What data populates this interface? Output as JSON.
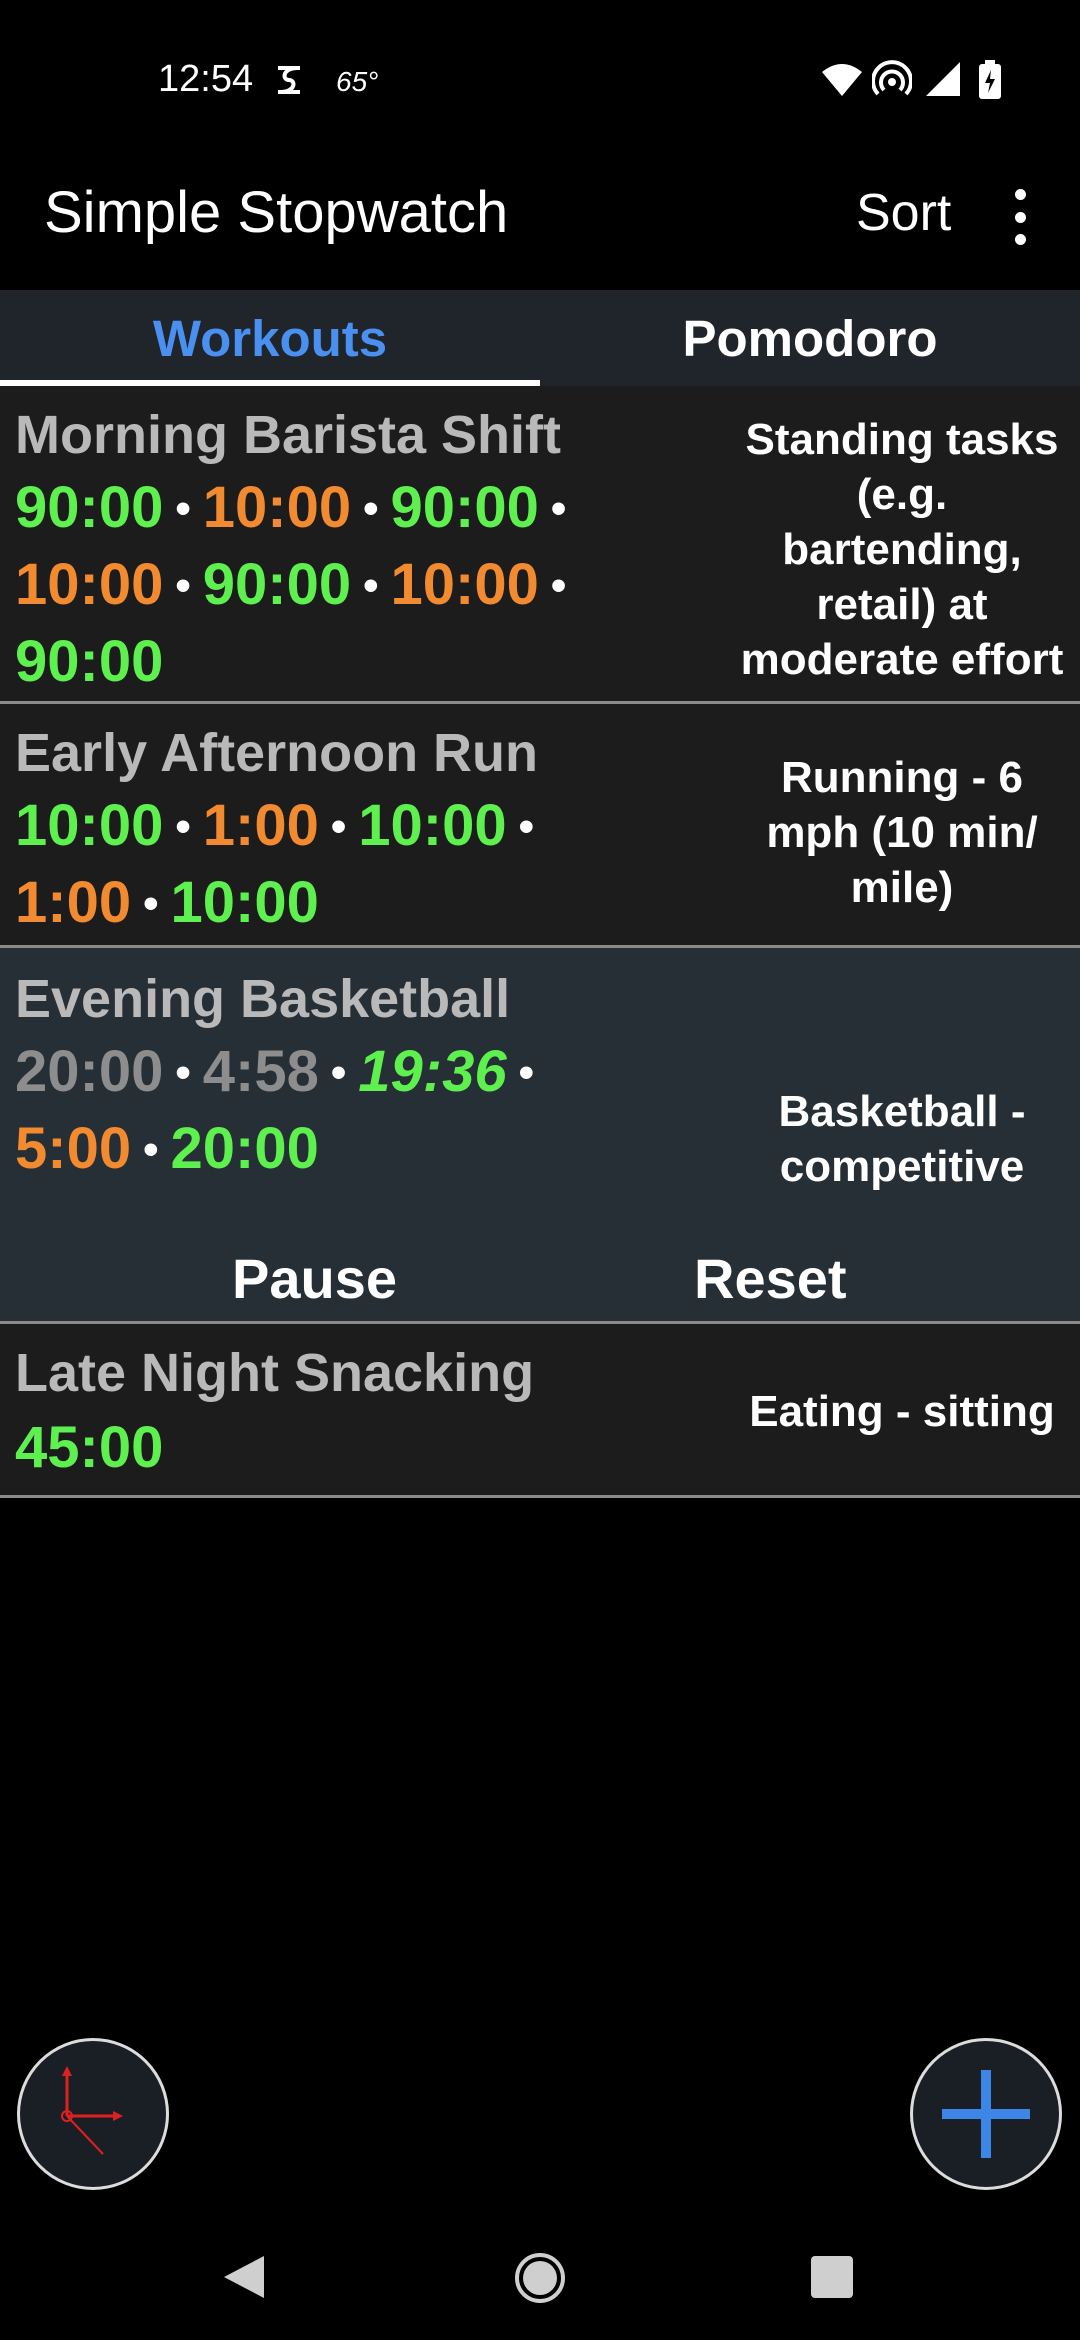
{
  "status_bar": {
    "time": "12:54",
    "temperature": "65°"
  },
  "app_bar": {
    "title": "Simple Stopwatch",
    "sort_label": "Sort",
    "more_icon": "more-vert-icon"
  },
  "tabs": [
    {
      "label": "Workouts",
      "selected": true
    },
    {
      "label": "Pomodoro",
      "selected": false
    }
  ],
  "colors": {
    "active_interval": "#5ef04e",
    "rest_interval": "#f28a30",
    "completed_interval": "#8d8d8d",
    "tab_selected": "#4a90f0",
    "fab_plus": "#3b86e6"
  },
  "workouts": [
    {
      "title": "Morning Barista Shift",
      "intervals": [
        "90:00",
        "10:00",
        "90:00",
        "10:00",
        "90:00",
        "10:00",
        "90:00"
      ],
      "description": "Standing tasks (e.g. bartending, retail) at moderate effort"
    },
    {
      "title": "Early Afternoon Run",
      "intervals": [
        "10:00",
        "1:00",
        "10:00",
        "1:00",
        "10:00"
      ],
      "description": "Running - 6 mph (10 min/ mile)"
    },
    {
      "title": "Evening Basketball",
      "intervals": [
        "20:00",
        "4:58",
        "19:36",
        "5:00",
        "20:00"
      ],
      "description": "Basketball - competitive",
      "pause_label": "Pause",
      "reset_label": "Reset"
    },
    {
      "title": "Late Night Snacking",
      "intervals": [
        "45:00"
      ],
      "description": "Eating - sitting"
    }
  ]
}
